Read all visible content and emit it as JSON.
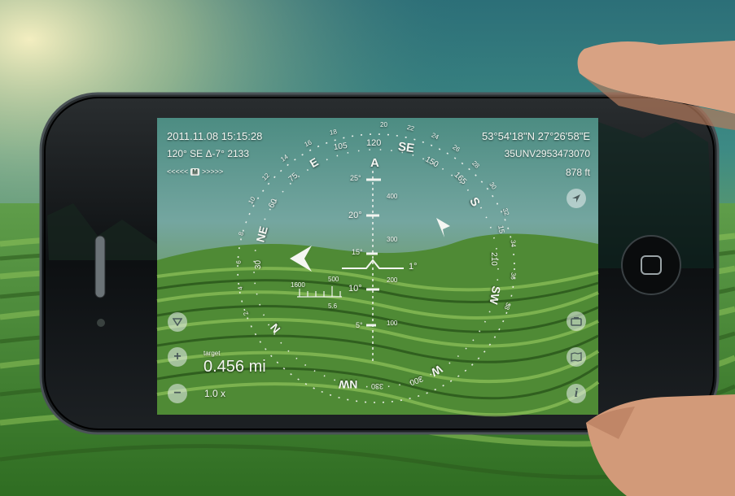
{
  "hud": {
    "datetime": "2011.11.08 15:15:28",
    "heading_line": "120° SE Δ-7° 2133",
    "coordinates": "53°54'18\"N 27°26'58\"E",
    "grid_ref": "35UNV2953473070",
    "altitude": "878 ft",
    "target_label": "target",
    "target_distance": "0.456 mi",
    "zoom": "1.0 x",
    "arrow_text": "<<<<<",
    "arrow_text_right": ">>>>>",
    "arrow_badge": "M",
    "pitch_mark": "1°"
  },
  "compass": {
    "cardinals": [
      "SE",
      "S",
      "SW",
      "W",
      "NW",
      "N",
      "NE",
      "E"
    ],
    "degrees": [
      "120",
      "105",
      "150",
      "165",
      "210",
      "300",
      "330",
      "30",
      "60",
      "75",
      "15"
    ],
    "small_ticks": [
      "20",
      "22",
      "24",
      "26",
      "28",
      "30",
      "32",
      "34",
      "36",
      "38",
      "18",
      "16",
      "14",
      "12",
      "10",
      "8",
      "6",
      "4",
      "2"
    ],
    "center_label": "A"
  },
  "ladder": {
    "degrees": [
      "25°",
      "20°",
      "15°",
      "10°",
      "5°"
    ],
    "distances": [
      "400",
      "300",
      "200",
      "100"
    ]
  },
  "scale_bar": {
    "top": "1600",
    "mid": "500",
    "bottom": "5.6"
  },
  "buttons": {
    "location_icon": "location-arrow-icon",
    "dropdown_icon": "triangle-down-icon",
    "zoom_in_icon": "plus-icon",
    "zoom_out_icon": "minus-icon",
    "camera_icon": "camera-icon",
    "map_icon": "map-icon",
    "info_icon": "info-icon"
  }
}
